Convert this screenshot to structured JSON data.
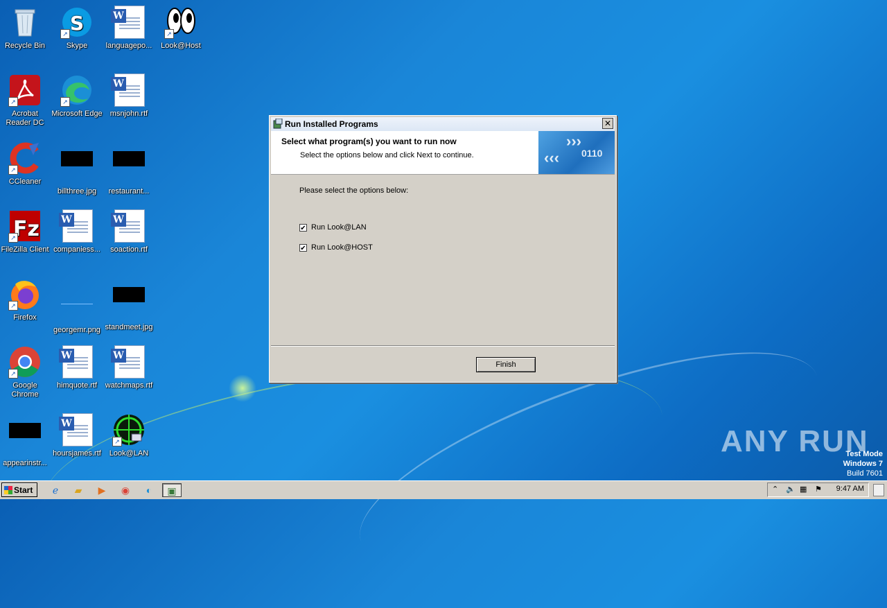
{
  "desktop": {
    "icons": [
      {
        "label": "Recycle Bin"
      },
      {
        "label": "Skype"
      },
      {
        "label": "languagepo..."
      },
      {
        "label": "Look@Host"
      },
      {
        "label": "Acrobat Reader DC"
      },
      {
        "label": "Microsoft Edge"
      },
      {
        "label": "msnjohn.rtf"
      },
      {
        "label": "CCleaner"
      },
      {
        "label": "billthree.jpg"
      },
      {
        "label": "restaurant..."
      },
      {
        "label": "FileZilla Client"
      },
      {
        "label": "companiess..."
      },
      {
        "label": "soaction.rtf"
      },
      {
        "label": "Firefox"
      },
      {
        "label": "georgemr.png"
      },
      {
        "label": "standmeet.jpg"
      },
      {
        "label": "Google Chrome"
      },
      {
        "label": "himquote.rtf"
      },
      {
        "label": "watchmaps.rtf"
      },
      {
        "label": "appearinstr..."
      },
      {
        "label": "hoursjames.rtf"
      },
      {
        "label": "Look@LAN"
      }
    ]
  },
  "dialog": {
    "title": "Run Installed Programs",
    "header_title": "Select what program(s) you want to run now",
    "header_subtitle": "Select the options below and click Next to continue.",
    "prompt": "Please select the options below:",
    "options": [
      {
        "label": "Run Look@LAN",
        "checked": true
      },
      {
        "label": "Run Look@HOST",
        "checked": true
      }
    ],
    "finish_label": "Finish",
    "close_glyph": "✕"
  },
  "taskbar": {
    "start_label": "Start",
    "clock": "9:47 AM"
  },
  "watermark": {
    "brand": "ANY RUN",
    "mode": "Test Mode",
    "os": "Windows 7",
    "build": "Build 7601"
  }
}
